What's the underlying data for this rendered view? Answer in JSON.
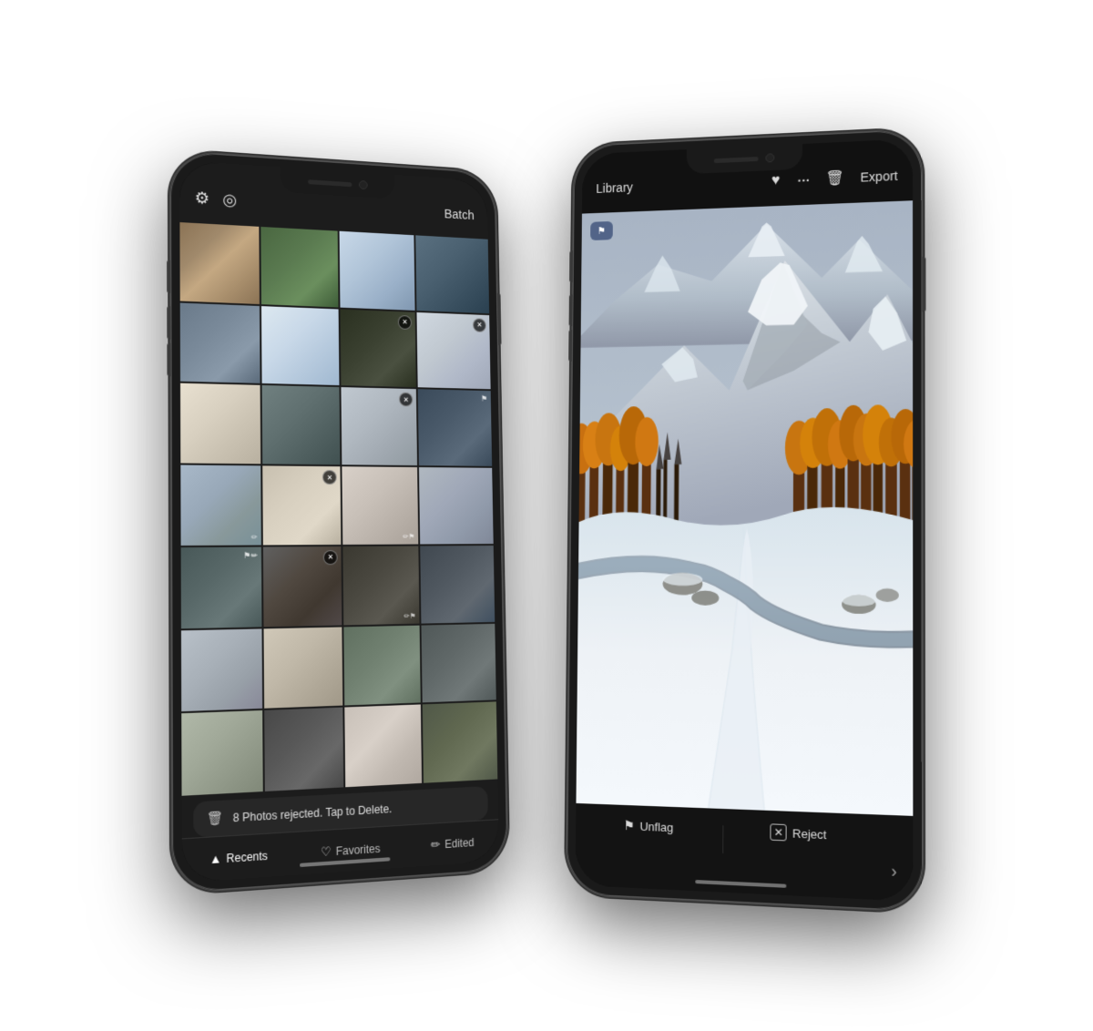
{
  "scene": {
    "background": "#ffffff"
  },
  "phone_left": {
    "header": {
      "settings_icon": "⚙",
      "logo_icon": "◎",
      "batch_label": "Batch"
    },
    "grid": {
      "photos": [
        {
          "id": 1,
          "class": "p1",
          "badge": null,
          "flag": false,
          "edit": false
        },
        {
          "id": 2,
          "class": "p2",
          "badge": null,
          "flag": false,
          "edit": false
        },
        {
          "id": 3,
          "class": "p3",
          "badge": null,
          "flag": false,
          "edit": false
        },
        {
          "id": 4,
          "class": "p4",
          "badge": null,
          "flag": false,
          "edit": false
        },
        {
          "id": 5,
          "class": "p5",
          "badge": null,
          "flag": false,
          "edit": false
        },
        {
          "id": 6,
          "class": "p6",
          "badge": null,
          "flag": false,
          "edit": false
        },
        {
          "id": 7,
          "class": "p7",
          "badge": "✕",
          "flag": false,
          "edit": false
        },
        {
          "id": 8,
          "class": "p8",
          "badge": "✕",
          "flag": false,
          "edit": false
        },
        {
          "id": 9,
          "class": "p9",
          "badge": null,
          "flag": false,
          "edit": false
        },
        {
          "id": 10,
          "class": "p10",
          "badge": null,
          "flag": false,
          "edit": false
        },
        {
          "id": 11,
          "class": "p11",
          "badge": "✕",
          "flag": false,
          "edit": false
        },
        {
          "id": 12,
          "class": "p12",
          "badge": null,
          "flag": true,
          "edit": false
        },
        {
          "id": 13,
          "class": "p13",
          "badge": null,
          "flag": false,
          "edit": true
        },
        {
          "id": 14,
          "class": "p14",
          "badge": "✕",
          "flag": false,
          "edit": false
        },
        {
          "id": 15,
          "class": "p15",
          "badge": null,
          "flag": false,
          "edit": true
        },
        {
          "id": 16,
          "class": "p16",
          "badge": null,
          "flag": false,
          "edit": false
        },
        {
          "id": 17,
          "class": "p17",
          "badge": null,
          "flag": true,
          "edit": false
        },
        {
          "id": 18,
          "class": "p18",
          "badge": "✕",
          "flag": false,
          "edit": false
        },
        {
          "id": 19,
          "class": "p19",
          "badge": null,
          "flag": false,
          "edit": true
        },
        {
          "id": 20,
          "class": "p20",
          "badge": null,
          "flag": true,
          "edit": false
        },
        {
          "id": 21,
          "class": "p21",
          "badge": null,
          "flag": false,
          "edit": false
        },
        {
          "id": 22,
          "class": "p22",
          "badge": null,
          "flag": false,
          "edit": false
        },
        {
          "id": 23,
          "class": "p23",
          "badge": null,
          "flag": false,
          "edit": false
        },
        {
          "id": 24,
          "class": "p24",
          "badge": null,
          "flag": false,
          "edit": false
        },
        {
          "id": 25,
          "class": "p25",
          "badge": null,
          "flag": false,
          "edit": false
        },
        {
          "id": 26,
          "class": "p26",
          "badge": null,
          "flag": false,
          "edit": false
        },
        {
          "id": 27,
          "class": "p27",
          "badge": null,
          "flag": false,
          "edit": false
        },
        {
          "id": 28,
          "class": "p28",
          "badge": null,
          "flag": false,
          "edit": false
        }
      ]
    },
    "notification": {
      "icon": "🗑",
      "text": "8 Photos rejected. Tap to Delete."
    },
    "tabs": [
      {
        "label": "Recents",
        "icon": "▲",
        "active": true
      },
      {
        "label": "Favorites",
        "icon": "♡",
        "active": false
      },
      {
        "label": "Edited",
        "icon": "✏",
        "active": false
      }
    ]
  },
  "phone_right": {
    "header": {
      "library_label": "Library",
      "heart_icon": "♥",
      "more_icon": "•••",
      "trash_icon": "🗑",
      "export_label": "Export"
    },
    "photo": {
      "flag_icon": "⚑",
      "flag_label": ""
    },
    "bottom_actions": [
      {
        "icon": "⚑",
        "label": "Unflag"
      },
      {
        "icon": "✕",
        "label": "Reject"
      },
      {
        "icon": "›",
        "label": ""
      }
    ]
  }
}
